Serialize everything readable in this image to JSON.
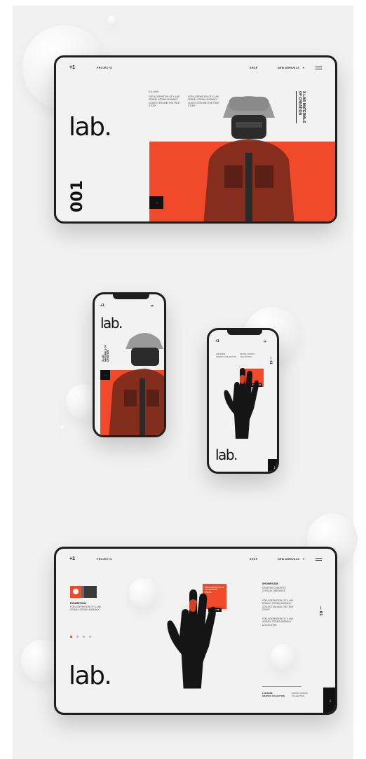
{
  "brand": "+1",
  "nav": {
    "projects": "PROJECTS",
    "shop": "SHOP",
    "new_arrivals": "NEW ARRIVALS",
    "dropdown_glyph": "▼"
  },
  "logo": "lab.",
  "hero": {
    "tag": "X/LABS",
    "text_left": "FOR A DEFINITION OF X-LAB GRAVEL STRING ANOMALY COLLECTION AND THE TRUE STORY",
    "text_right": "FOR A DEFINITION OF X-LAB GRAVEL STRING ANOMALY COLLECTION AND THE TRUE STORY",
    "vertical_title": "X-LAB MATERIALS OF CREATION",
    "number": "001",
    "arrow": "→",
    "footer_note": "X-LAB/1987"
  },
  "phone1": {
    "signal": "▮▮",
    "vertical_title": "X-LAB MATERIALS OF CREATION",
    "arrow": "→"
  },
  "phone2": {
    "col_left": "LAB MADE\nGRAPHIC COLLECTION",
    "col_right": "DIGITAL CANVAS\nCOLLECTION",
    "number": "— 01",
    "card_cta": "EXPAND",
    "arrow_down": "↓"
  },
  "tablet2": {
    "exhibition_title": "EXHIBITION",
    "exhibition_text": "FOR A DEFINITION OF X-LAB GRAVEL STRING ANOMALY",
    "card_text": "FOR A DEFINITION OF X-LAB GRAVEL STRING",
    "card_cta": "EXPAND",
    "right_heading": "SHOWROOM",
    "right_sub": "CRAFTED CONCEPTS\n& VISUAL LANGUAGE",
    "right_text1": "FOR A DEFINITION OF X-LAB GRAVEL STRING ANOMALY COLLECTION AND THE TRUE STORY",
    "right_text2": "FOR A DEFINITION OF X-LAB GRAVEL STRING ANOMALY COLLECTION",
    "number": "— 01",
    "footer_left": "LAB MADE\nGRAPHIC COLLECTION",
    "footer_right": "DIGITAL CANVAS\nCOLLECTION",
    "arrow_down": "↓"
  },
  "colors": {
    "accent": "#f04a2b",
    "dark": "#111111",
    "background": "#f1f1f1"
  }
}
